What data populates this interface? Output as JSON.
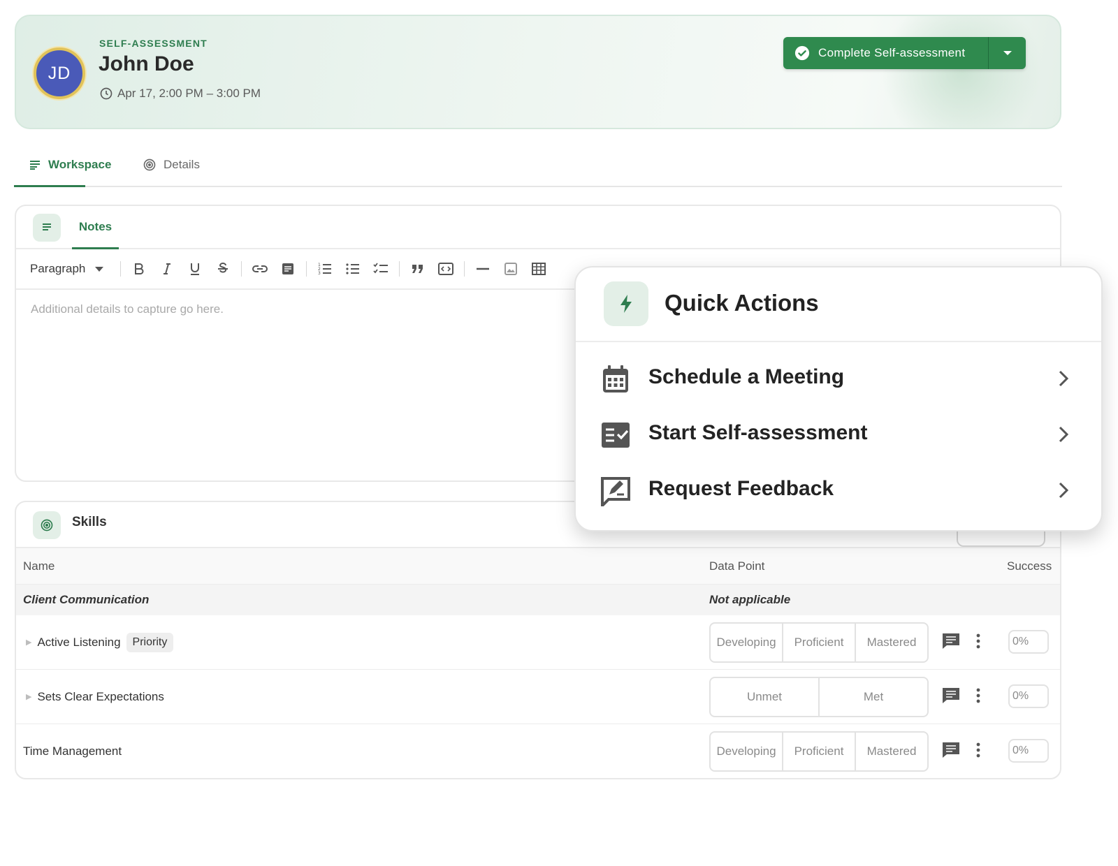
{
  "header": {
    "eyebrow": "SELF-ASSESSMENT",
    "initials": "JD",
    "name": "John Doe",
    "time": "Apr 17, 2:00 PM – 3:00 PM",
    "cta_label": "Complete Self-assessment",
    "accent": "#2f8a4e"
  },
  "tabs": [
    {
      "label": "Workspace",
      "active": true
    },
    {
      "label": "Details",
      "active": false
    }
  ],
  "notes": {
    "tab_label": "Notes",
    "paragraph_label": "Paragraph",
    "placeholder": "Additional details to capture go here."
  },
  "skills": {
    "title": "Skills",
    "columns": {
      "name": "Name",
      "data_point": "Data Point",
      "success": "Success"
    },
    "group": {
      "name": "Client Communication",
      "data_point": "Not applicable"
    },
    "rows": [
      {
        "name": "Active Listening",
        "badge": "Priority",
        "options": [
          "Developing",
          "Proficient",
          "Mastered"
        ],
        "success": "0%"
      },
      {
        "name": "Sets Clear Expectations",
        "options": [
          "Unmet",
          "Met"
        ],
        "success": "0%"
      },
      {
        "name": "Time Management",
        "options": [
          "Developing",
          "Proficient",
          "Mastered"
        ],
        "success": "0%"
      }
    ]
  },
  "quick_actions": {
    "title": "Quick Actions",
    "items": [
      {
        "label": "Schedule a Meeting",
        "icon": "calendar-icon"
      },
      {
        "label": "Start Self-assessment",
        "icon": "checklist-icon"
      },
      {
        "label": "Request Feedback",
        "icon": "feedback-icon"
      }
    ]
  }
}
